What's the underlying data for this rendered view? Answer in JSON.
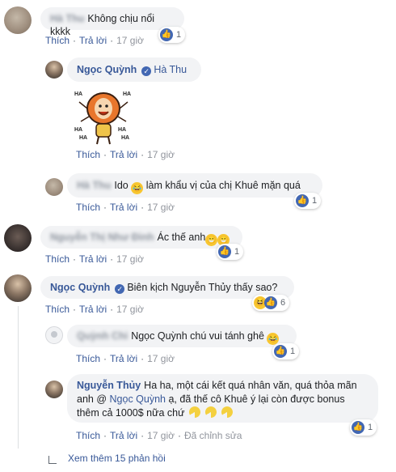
{
  "labels": {
    "like": "Thích",
    "reply": "Trả lời",
    "dot": "·",
    "edited": "Đã chỉnh sửa",
    "view_more": "Xem thêm 15 phản hồi"
  },
  "comments": [
    {
      "author": "Hà Thu",
      "text": "Không chịu nổi kkkk",
      "time": "17 giờ",
      "reactions": {
        "icons": [
          "like-icon"
        ],
        "count": "1"
      }
    },
    {
      "author": "Ngọc Quỳnh",
      "verified": true,
      "mention": "Hà Thu",
      "sticker": "laughing-sticker",
      "sticker_text": "HA",
      "time": "17 giờ"
    },
    {
      "author": "Hà Thu",
      "text": "Ido 😂 làm khẩu vị của chị Khuê mặn quá",
      "text_before": "Ido",
      "text_after": "làm khẩu vị của chị Khuê mặn quá",
      "time": "17 giờ",
      "reactions": {
        "icons": [
          "like-icon"
        ],
        "count": "1"
      }
    },
    {
      "author": "Nguyễn Thị Như Đinh",
      "text_before": "Ác thế anh",
      "time": "17 giờ",
      "reactions": {
        "icons": [
          "like-icon"
        ],
        "count": "1"
      }
    },
    {
      "author": "Ngọc Quỳnh",
      "verified": true,
      "text": "Biên kịch Nguyễn Thủy thấy sao?",
      "time": "17 giờ",
      "reactions": {
        "icons": [
          "haha-icon",
          "like-icon"
        ],
        "count": "6"
      }
    },
    {
      "author": "Quỳnh Chi",
      "mention": "Ngọc Quỳnh",
      "text_after": "chú vui tánh ghê",
      "time": "17 giờ",
      "reactions": {
        "icons": [
          "like-icon"
        ],
        "count": "1"
      }
    },
    {
      "author": "Nguyễn Thủy",
      "text_before": "Ha ha, một cái kết quá nhân văn, quá thỏa mãn anh @",
      "mention": "Ngọc Quỳnh",
      "text_after": "ạ, đã thế cô Khuê ý lại còn được bonus thêm cả 1000$ nữa chứ",
      "time": "17 giờ",
      "reactions": {
        "icons": [
          "like-icon"
        ],
        "count": "1"
      }
    }
  ]
}
